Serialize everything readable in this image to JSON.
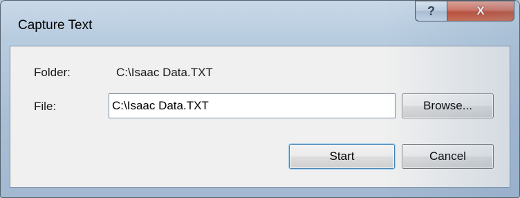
{
  "window": {
    "title": "Capture Text",
    "help_glyph": "?",
    "close_glyph": "X"
  },
  "form": {
    "folder_label": "Folder:",
    "folder_value": "C:\\Isaac Data.TXT",
    "file_label": "File:",
    "file_value": "C:\\Isaac Data.TXT"
  },
  "buttons": {
    "browse": "Browse...",
    "start": "Start",
    "cancel": "Cancel"
  },
  "colors": {
    "frame": "#b9cde0",
    "client": "#f0f0f0",
    "close_button": "#c2462d",
    "default_button_border": "#3c7fb1"
  }
}
